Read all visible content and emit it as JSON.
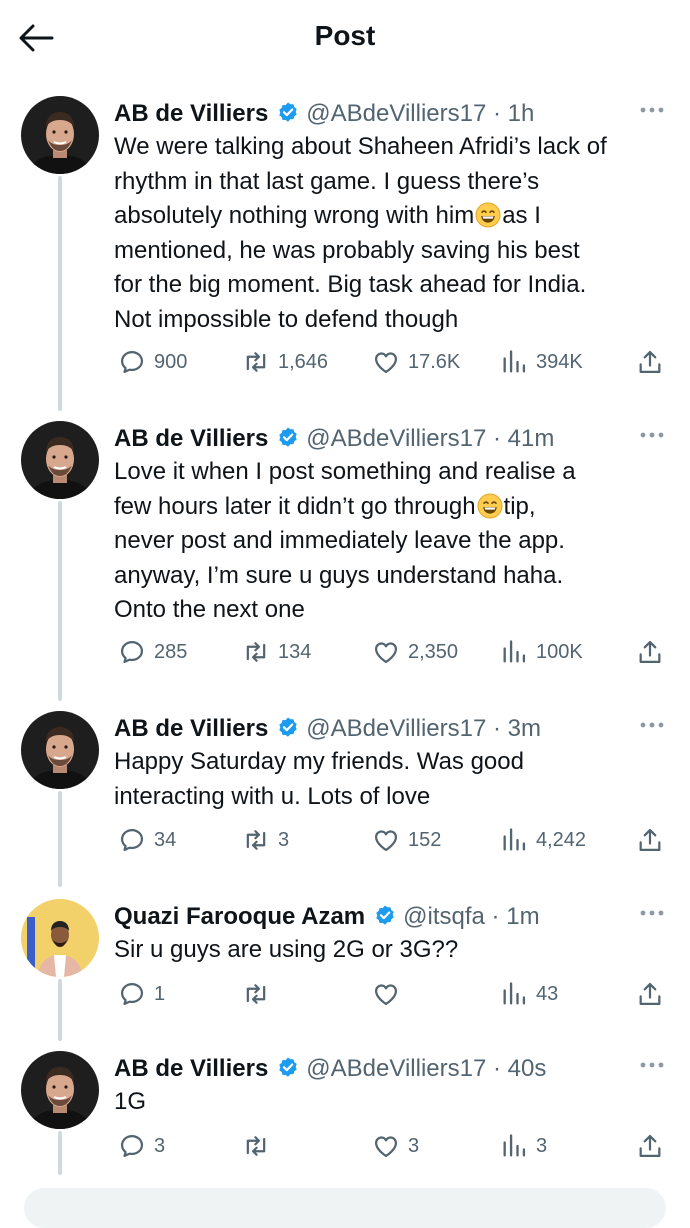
{
  "header": {
    "title": "Post"
  },
  "tweets": [
    {
      "name": "AB de Villiers",
      "handle": "@ABdeVilliers17",
      "time": "1h",
      "lines": [
        [
          "We were talking about Shaheen Afridi’s lack of"
        ],
        [
          "rhythm in that last game. I guess there’s"
        ],
        [
          "absolutely nothing wrong with him",
          "😄",
          "as I"
        ],
        [
          "mentioned, he was probably saving his best"
        ],
        [
          "for the big moment. Big task ahead for India."
        ],
        [
          "Not impossible to defend though"
        ]
      ],
      "replies": "900",
      "reposts": "1,646",
      "likes": "17.6K",
      "views": "394K"
    },
    {
      "name": "AB de Villiers",
      "handle": "@ABdeVilliers17",
      "time": "41m",
      "lines": [
        [
          "Love it when I post something and realise a"
        ],
        [
          "few hours later it didn’t go through",
          "😄",
          "tip,"
        ],
        [
          "never post and immediately leave the app."
        ],
        [
          "anyway, I’m sure u guys understand haha."
        ],
        [
          "Onto the next one"
        ]
      ],
      "replies": "285",
      "reposts": "134",
      "likes": "2,350",
      "views": "100K"
    },
    {
      "name": "AB de Villiers",
      "handle": "@ABdeVilliers17",
      "time": "3m",
      "lines": [
        [
          "Happy Saturday my friends. Was good"
        ],
        [
          "interacting with u. Lots of love"
        ]
      ],
      "replies": "34",
      "reposts": "3",
      "likes": "152",
      "views": "4,242"
    },
    {
      "name": "Quazi Farooque Azam",
      "handle": "@itsqfa",
      "time": "1m",
      "lines": [
        [
          "Sir u guys are using 2G or 3G??"
        ]
      ],
      "replies": "1",
      "reposts": "",
      "likes": "",
      "views": "43"
    },
    {
      "name": "AB de Villiers",
      "handle": "@ABdeVilliers17",
      "time": "40s",
      "lines": [
        [
          "1G"
        ]
      ],
      "replies": "3",
      "reposts": "",
      "likes": "3",
      "views": "3"
    }
  ],
  "colors": {
    "verified": "#1d9bf0",
    "secondary_text": "#536471",
    "thread_line": "#cfd9de"
  }
}
